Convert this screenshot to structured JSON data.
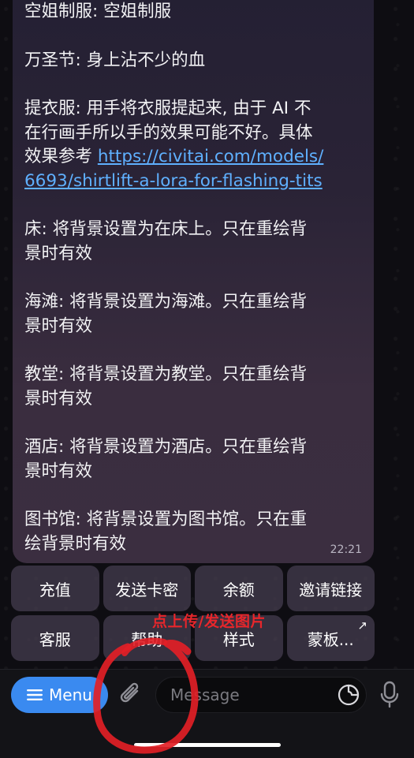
{
  "message": {
    "lines": [
      "空姐制服: 空姐制服",
      "",
      "万圣节: 身上沾不少的血",
      "",
      "提衣服: 用手将衣服提起来, 由于 AI 不",
      "在行画手所以手的效果可能不好。具体",
      "LINK1",
      "LINK2",
      "",
      "床: 将背景设置为在床上。只在重绘背",
      "景时有效",
      "",
      "海滩: 将背景设置为海滩。只在重绘背",
      "景时有效",
      "",
      "教堂: 将背景设置为教堂。只在重绘背",
      "景时有效",
      "",
      "酒店: 将背景设置为酒店。只在重绘背",
      "景时有效",
      "",
      "图书馆: 将背景设置为图书馆。只在重",
      "绘背景时有效"
    ],
    "link_prefix": "效果参考 ",
    "link_line1": "https://civitai.com/models/",
    "link_line2": "6693/shirtlift-a-lora-for-flashing-tits",
    "time": "22:21"
  },
  "keyboard": {
    "row1": [
      "充值",
      "发送卡密",
      "余额",
      "邀请链接"
    ],
    "row2": [
      "客服",
      "帮助",
      "样式",
      "蒙板..."
    ],
    "external_icon": "arrow-up-right-icon"
  },
  "composer": {
    "menu_label": "Menu",
    "placeholder": "Message",
    "icons": [
      "menu-lines-icon",
      "paperclip-icon",
      "sticker-icon",
      "microphone-icon"
    ]
  },
  "annotation": {
    "text": "点上传/发送图片",
    "color": "#e8262b"
  },
  "colors": {
    "accent": "#3a8af0",
    "link": "#5fb0ff"
  }
}
